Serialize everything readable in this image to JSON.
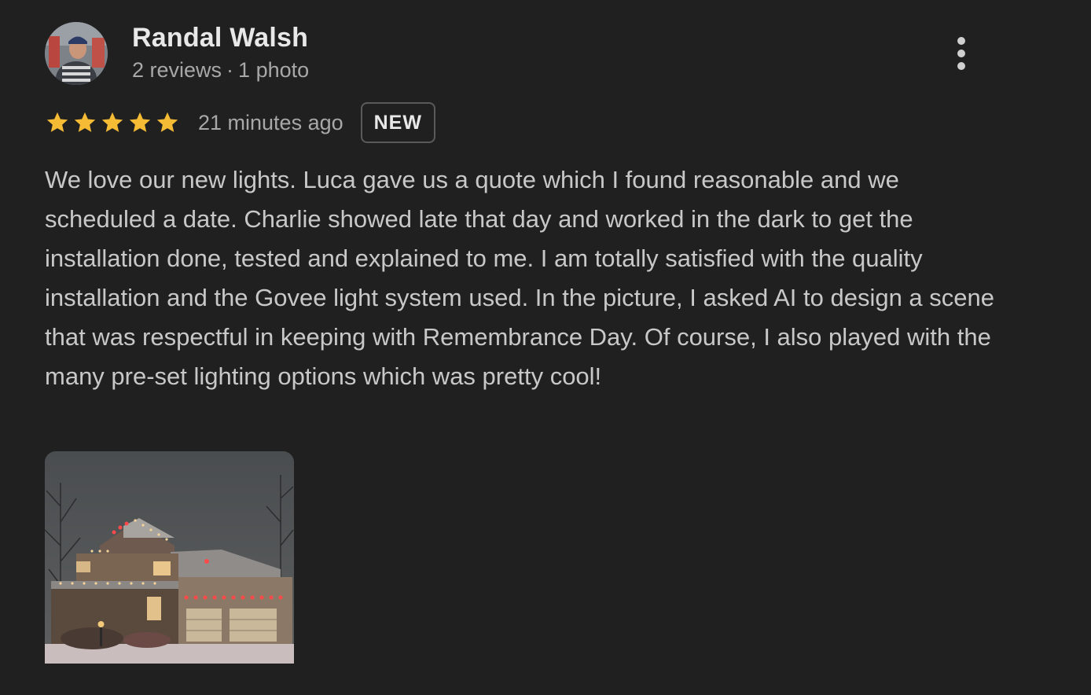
{
  "review": {
    "author": {
      "name": "Randal Walsh",
      "reviews_count": "2 reviews",
      "separator": "·",
      "photos_count": "1 photo",
      "avatar_icon": "user-avatar"
    },
    "more_options_icon": "vertical-dots-icon",
    "rating": {
      "stars": 5,
      "max_stars": 5,
      "star_color": "#f6bb34"
    },
    "time": "21 minutes ago",
    "badge": "NEW",
    "text": "We love our new lights. Luca gave us a quote which I found reasonable and we scheduled a date. Charlie showed late that day and worked in the dark to get the installation done, tested and explained to me. I am totally satisfied with the quality installation and the Govee light system used. In the picture, I asked AI to design a scene that was respectful in keeping with Remembrance Day. Of course, I also played with the many pre-set lighting options which was pretty cool!",
    "photos": [
      {
        "subject": "house-with-red-lights"
      }
    ]
  },
  "colors": {
    "background": "#202020",
    "text_primary": "#e8e8e8",
    "text_secondary": "#a8a8a8",
    "body_text": "#c8c8c8"
  }
}
